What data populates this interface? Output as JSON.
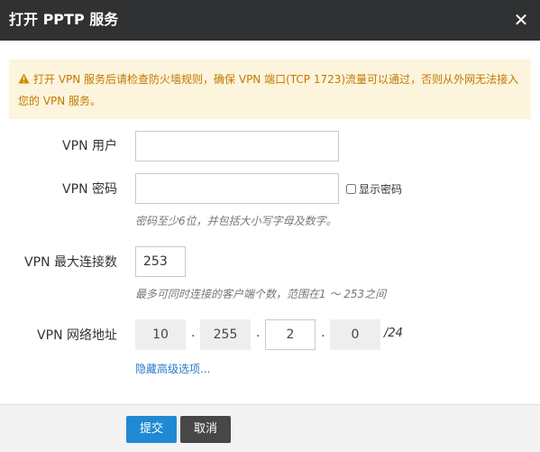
{
  "dialog": {
    "title": "打开 PPTP 服务",
    "close_icon": "close-icon"
  },
  "alert": {
    "icon": "warning-icon",
    "line1": "打开 VPN 服务后请检查防火墙规则，确保 VPN 端口(TCP 1723)流量可以通过，否则从外网无法接入",
    "line2": "您的 VPN 服务。",
    "color": "#c07a00",
    "background": "#fcf4dc"
  },
  "form": {
    "user": {
      "label": "VPN 用户",
      "value": ""
    },
    "password": {
      "label": "VPN 密码",
      "value": "",
      "show_label": "显示密码",
      "hint": "密码至少6位，并包括大小写字母及数字。"
    },
    "max_conn": {
      "label": "VPN 最大连接数",
      "value": "253",
      "hint": "最多可同时连接的客户端个数，范围在1 ～ 253之间"
    },
    "network": {
      "label": "VPN 网络地址",
      "octets": [
        "10",
        "255",
        "2",
        "0"
      ],
      "cidr": "/24"
    },
    "advanced_link": "隐藏高级选项..."
  },
  "footer": {
    "submit_label": "提交",
    "cancel_label": "取消",
    "submit_color": "#1f8ad3",
    "cancel_color": "#474747"
  }
}
